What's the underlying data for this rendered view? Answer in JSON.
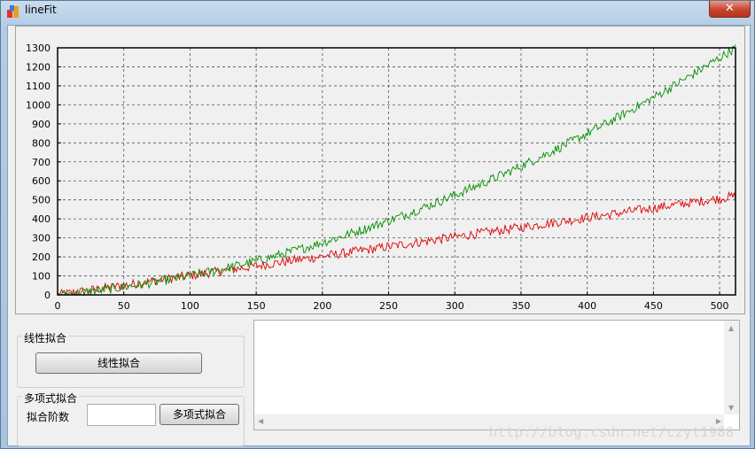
{
  "window": {
    "title": "lineFit",
    "close_label": "✕"
  },
  "linear_group": {
    "title": "线性拟合",
    "button_label": "线性拟合"
  },
  "poly_group": {
    "title": "多项式拟合",
    "order_label": "拟合阶数",
    "order_value": "",
    "button_label": "多项式拟合"
  },
  "output_box": {
    "value": ""
  },
  "watermark": "http://blog.csdn.net/czyt1988",
  "chart_data": {
    "type": "line",
    "xlim": [
      0,
      512
    ],
    "ylim": [
      0,
      1300
    ],
    "xticks": [
      0,
      50,
      100,
      150,
      200,
      250,
      300,
      350,
      400,
      450,
      500
    ],
    "yticks": [
      0,
      100,
      200,
      300,
      400,
      500,
      600,
      700,
      800,
      900,
      1000,
      1100,
      1200,
      1300
    ],
    "grid": true,
    "series": [
      {
        "color": "#e00000",
        "shape": "linear",
        "end_value": 520,
        "noise": 25
      },
      {
        "color": "#009000",
        "shape": "quadratic",
        "end_value": 1300,
        "noise": 25
      }
    ]
  }
}
